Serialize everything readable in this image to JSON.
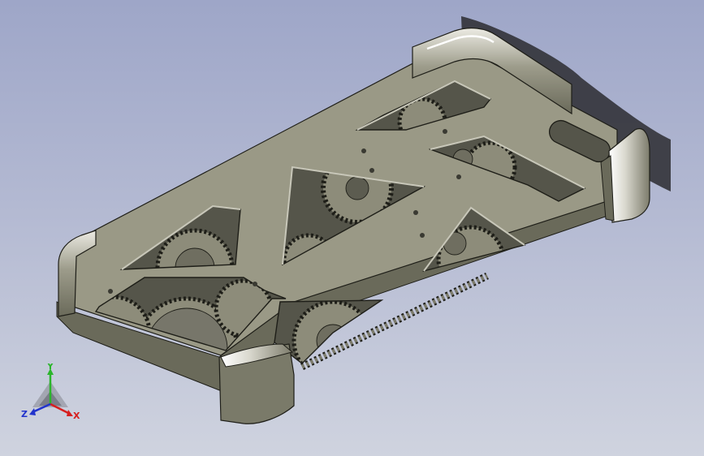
{
  "viewport": {
    "model": "iphone-case-with-gears",
    "colors": {
      "background_top": "#9ea6c8",
      "background_bottom": "#cfd3df",
      "plate_top": "#999885",
      "plate_side": "#6e6e5e",
      "gear": "#898876",
      "edge": "#1e1e18",
      "highlight": "#ecebe3"
    }
  },
  "triad": {
    "x_label": "X",
    "y_label": "Y",
    "z_label": "Z",
    "x_color": "#d61f1f",
    "y_color": "#2bb52b",
    "z_color": "#2233cc"
  }
}
